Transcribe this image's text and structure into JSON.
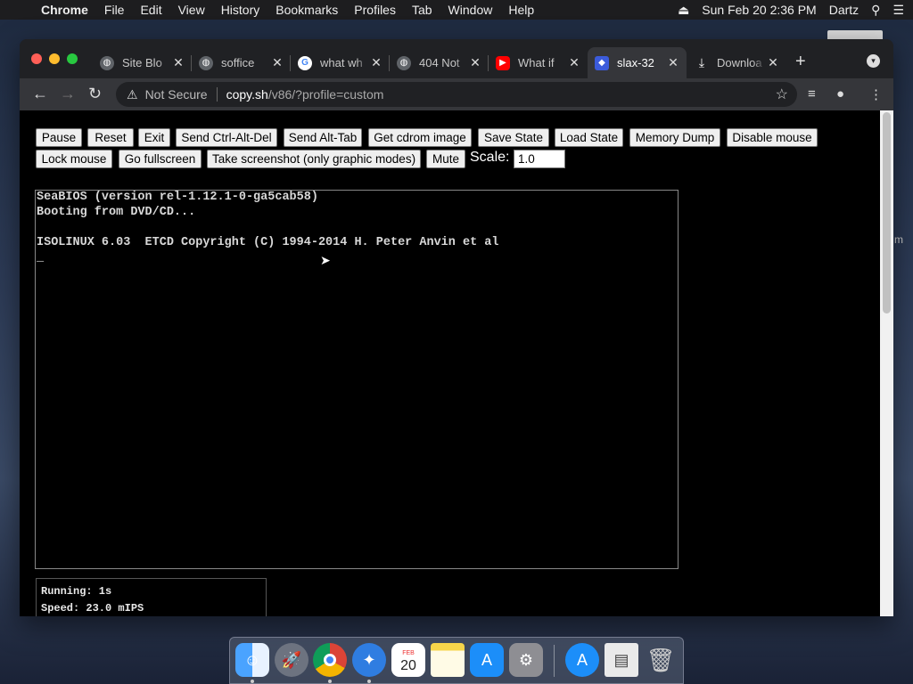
{
  "menubar": {
    "app": "Chrome",
    "items": [
      "File",
      "Edit",
      "View",
      "History",
      "Bookmarks",
      "Profiles",
      "Tab",
      "Window",
      "Help"
    ],
    "datetime": "Sun Feb 20  2:36 PM",
    "user": "Dartz"
  },
  "tabs": [
    {
      "label": "Site Blo",
      "favicon": "globe-icon",
      "color": "#5f6368"
    },
    {
      "label": "soffice",
      "favicon": "globe-icon",
      "color": "#5f6368"
    },
    {
      "label": "what wh",
      "favicon": "google-icon",
      "color": "#ffffff"
    },
    {
      "label": "404 Not",
      "favicon": "globe-icon",
      "color": "#5f6368"
    },
    {
      "label": "What if",
      "favicon": "youtube-icon",
      "color": "#ff0000"
    },
    {
      "label": "slax-32",
      "favicon": "v86-icon",
      "color": "#3b5bdb",
      "active": true
    },
    {
      "label": "Downloa",
      "favicon": "download-icon",
      "color": "#202124"
    }
  ],
  "omnibox": {
    "security": "Not Secure",
    "host": "copy.sh",
    "path": "/v86/?profile=custom"
  },
  "controls": {
    "buttons_row1": [
      "Pause",
      "Reset",
      "Exit",
      "Send Ctrl-Alt-Del",
      "Send Alt-Tab",
      "Get cdrom image",
      "Save State",
      "Load State",
      "Memory Dump",
      "Disable mouse"
    ],
    "buttons_row2": [
      "Lock mouse",
      "Go fullscreen",
      "Take screenshot (only graphic modes)",
      "Mute"
    ],
    "scale_label": "Scale:",
    "scale_value": "1.0"
  },
  "screen": {
    "lines": [
      "SeaBIOS (version rel-1.12.1-0-ga5cab58)",
      "Booting from DVD/CD...",
      "",
      "ISOLINUX 6.03  ETCD Copyright (C) 1994-2014 H. Peter Anvin et al",
      "_"
    ]
  },
  "stats": {
    "running": "Running: 1s",
    "speed": "Speed: 23.0 mIPS"
  },
  "dock": {
    "apps": [
      "Finder",
      "Launchpad",
      "Google Chrome",
      "Safari",
      "Calendar",
      "Notes",
      "App Store",
      "System Preferences",
      "Downloads",
      "Document",
      "Trash"
    ],
    "calendar_month": "FEB",
    "calendar_day": "20"
  },
  "desktop_sliver": "m"
}
